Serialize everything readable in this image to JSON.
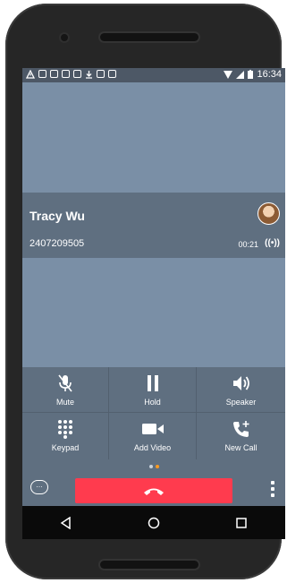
{
  "status_bar": {
    "time": "16:34",
    "left_icons": [
      "alert-icon",
      "voicemail-icon",
      "message-icon",
      "image-icon",
      "chat-icon",
      "download-icon",
      "sim-icon",
      "gallery-icon"
    ],
    "right_icons": [
      "wifi-icon",
      "signal-icon",
      "battery-icon"
    ]
  },
  "call": {
    "contact_name": "Tracy Wu",
    "contact_number": "2407209505",
    "duration": "00:21",
    "live_indicator": "((•))"
  },
  "controls": [
    {
      "label": "Mute",
      "icon": "mic-off-icon"
    },
    {
      "label": "Hold",
      "icon": "pause-icon"
    },
    {
      "label": "Speaker",
      "icon": "speaker-icon"
    },
    {
      "label": "Keypad",
      "icon": "keypad-icon"
    },
    {
      "label": "Add Video",
      "icon": "video-camera-icon"
    },
    {
      "label": "New Call",
      "icon": "phone-add-icon"
    }
  ],
  "page_indicator": {
    "count": 2,
    "active": 1
  },
  "colors": {
    "background": "#7a8fa6",
    "panel": "#5f6f80",
    "end_call": "#ff3b4e",
    "accent_dot": "#ff9a1f"
  },
  "nav": [
    "back-icon",
    "home-icon",
    "recents-icon"
  ]
}
